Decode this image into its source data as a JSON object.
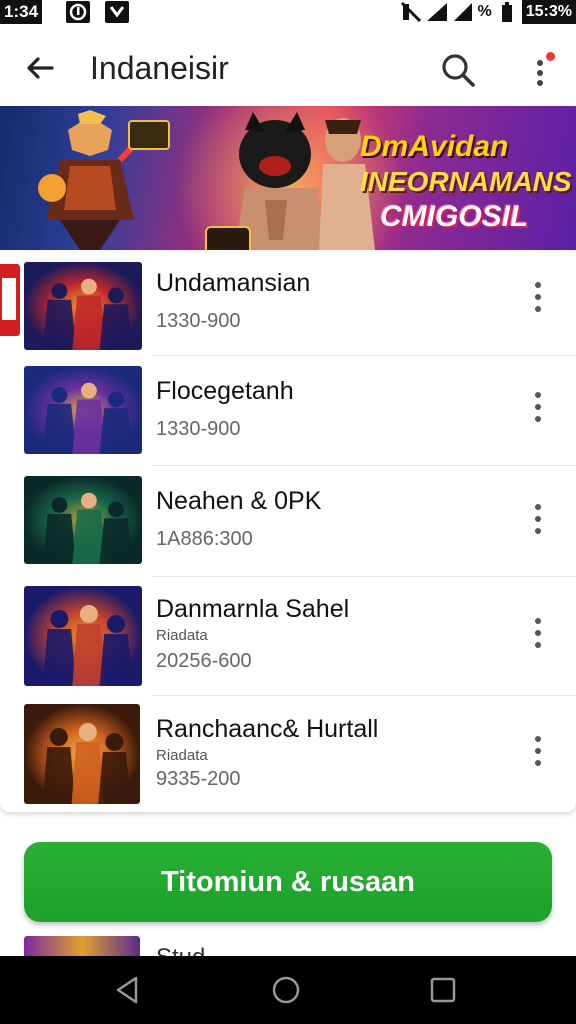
{
  "status_bar": {
    "time": "1:34",
    "right_text": "%",
    "battery_text": "15:3%"
  },
  "app_bar": {
    "title": "Indaneisir"
  },
  "banner": {
    "line1": "DmAvidan",
    "line2": "INEORNAMANS",
    "line3": "CMIGOSIL"
  },
  "list": [
    {
      "title": "Undamansian",
      "subtitle": "",
      "meta": "1330-900",
      "thumb_colors": [
        "#1d1a5a",
        "#c0282a",
        "#f0a030"
      ]
    },
    {
      "title": "Flocegetanh",
      "subtitle": "",
      "meta": "1330-900",
      "thumb_colors": [
        "#1a2a7a",
        "#6a30a0",
        "#e0b040"
      ]
    },
    {
      "title": "Neahen & 0PK",
      "subtitle": "",
      "meta": "1A886:300",
      "thumb_colors": [
        "#0a2a2a",
        "#1a6a4a",
        "#c0a030"
      ]
    },
    {
      "title": "Danmarnla Sahel",
      "subtitle": "Riadata",
      "meta": "20256-600",
      "thumb_colors": [
        "#1a1a6a",
        "#c04030",
        "#f09020"
      ]
    },
    {
      "title": "Ranchaanc& Hurtall",
      "subtitle": "Riadata",
      "meta": "9335-200",
      "thumb_colors": [
        "#3a1a0a",
        "#d06020",
        "#f0b040"
      ]
    }
  ],
  "cta": {
    "label": "Titomiun & rusaan"
  },
  "peek": {
    "text": "Stud..."
  },
  "colors": {
    "accent_green": "#1ba12a",
    "notification_red": "#e53935"
  }
}
